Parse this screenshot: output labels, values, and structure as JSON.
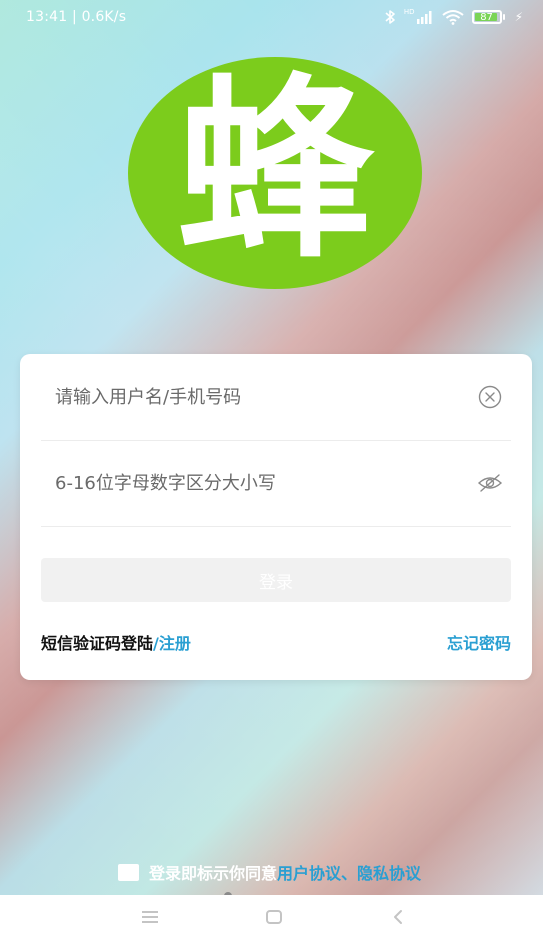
{
  "status_bar": {
    "time_speed": "13:41 | 0.6K/s",
    "network_label": "HD",
    "battery_level": "87",
    "icons": [
      "bluetooth-icon",
      "signal-icon",
      "wifi-icon",
      "battery-icon",
      "charging-icon"
    ]
  },
  "logo": {
    "char": "蜂",
    "color": "#7ccc1c"
  },
  "login_form": {
    "username_placeholder": "请输入用户名/手机号码",
    "password_placeholder": "6-16位字母数字区分大小写",
    "login_button_label": "登录",
    "sms_login_label": "短信验证码登陆",
    "separator": "/",
    "register_label": "注册",
    "forgot_password_label": "忘记密码"
  },
  "agreement": {
    "prefix_text": "登录即标示你同意",
    "user_agreement_label": "用户协议",
    "separator": "、",
    "privacy_label": "隐私协议"
  },
  "colors": {
    "accent_blue": "#2a9fd2",
    "logo_green": "#7ccc1c",
    "card_bg": "#ffffff"
  }
}
